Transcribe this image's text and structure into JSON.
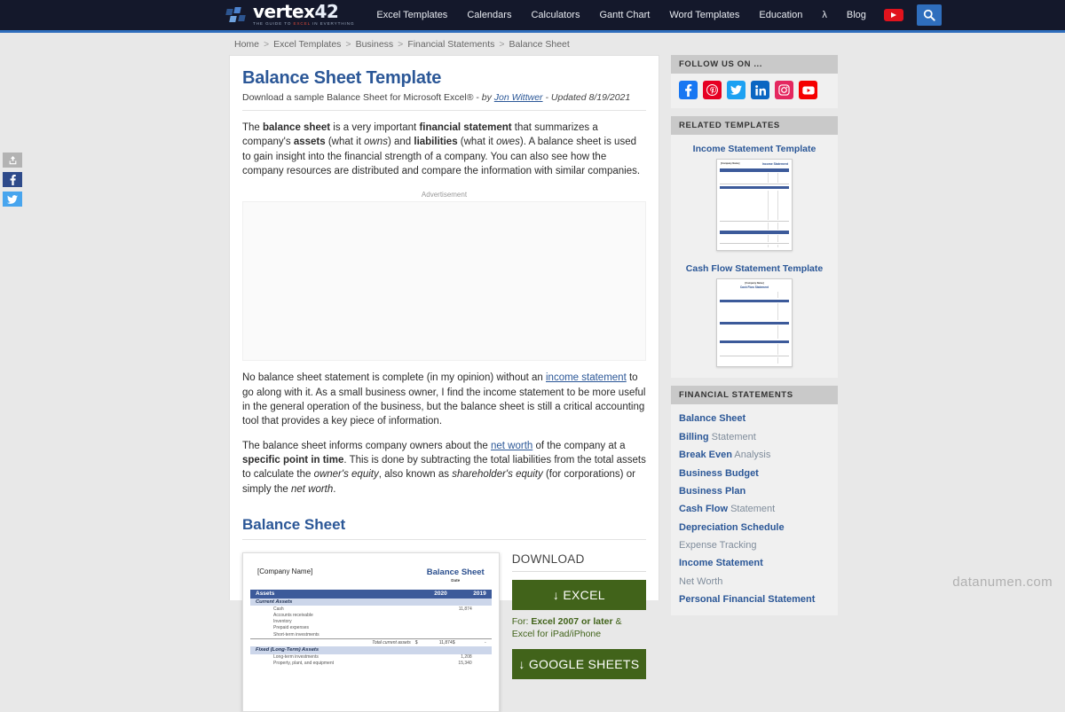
{
  "header": {
    "logo": {
      "word": "vertex",
      "number": "42",
      "tagline_prefix": "THE GUIDE TO ",
      "tagline_highlight": "EXCEL",
      "tagline_suffix": " IN EVERYTHING"
    },
    "nav": [
      {
        "label": "Excel Templates"
      },
      {
        "label": "Calendars"
      },
      {
        "label": "Calculators"
      },
      {
        "label": "Gantt Chart"
      },
      {
        "label": "Word Templates"
      },
      {
        "label": "Education"
      },
      {
        "label": "λ"
      },
      {
        "label": "Blog"
      }
    ],
    "youtube_icon": "youtube-play-icon",
    "search_icon": "search-icon"
  },
  "breadcrumb": {
    "separator": ">",
    "items": [
      "Home",
      "Excel Templates",
      "Business",
      "Financial Statements",
      "Balance Sheet"
    ]
  },
  "share_rail": [
    {
      "name": "share-more-button",
      "icon": "share-icon"
    },
    {
      "name": "share-facebook-button",
      "icon": "facebook-icon"
    },
    {
      "name": "share-twitter-button",
      "icon": "twitter-icon"
    }
  ],
  "main": {
    "title": "Balance Sheet Template",
    "subtitle_lead": "Download a sample Balance Sheet for Microsoft Excel® - ",
    "subtitle_by": "by ",
    "subtitle_author": "Jon Wittwer",
    "subtitle_updated": " - Updated 8/19/2021",
    "paragraph1": {
      "s1": "The ",
      "b1": "balance sheet",
      "s2": " is a very important ",
      "b2": "financial statement",
      "s3": " that summarizes a company's ",
      "b3": "assets",
      "s4": " (what it ",
      "i1": "owns",
      "s5": ") and ",
      "b4": "liabilities",
      "s6": " (what it ",
      "i2": "owes",
      "s7": "). A balance sheet is used to gain insight into the financial strength of a company. You can also see how the company resources are distributed and compare the information with similar companies."
    },
    "ad_label": "Advertisement",
    "paragraph2": {
      "s1": "No balance sheet statement is complete (in my opinion) without an ",
      "link": "income statement",
      "s2": " to go along with it. As a small business owner, I find the income statement to be more useful in the general operation of the business, but the balance sheet is still a critical accounting tool that provides a key piece of information."
    },
    "paragraph3": {
      "s1": "The balance sheet informs company owners about the ",
      "link": "net worth",
      "s2": " of the company at a ",
      "b1": "specific point in time",
      "s3": ". This is done by subtracting the total liabilities from the total assets to calculate the ",
      "i1": "owner's equity",
      "s4": ", also known as ",
      "i2": "shareholder's equity",
      "s5": " (for corporations) or simply the ",
      "i3": "net worth",
      "s6": "."
    },
    "section_heading": "Balance Sheet"
  },
  "preview": {
    "company": "[Company Name]",
    "title": "Balance Sheet",
    "date_label": "Date",
    "header_row": {
      "label": "Assets",
      "year1": "2020",
      "year2": "2019"
    },
    "current_assets_label": "Current Assets",
    "current_assets_rows": [
      {
        "label": "Cash",
        "value": "11,874"
      },
      {
        "label": "Accounts receivable",
        "value": ""
      },
      {
        "label": "Inventory",
        "value": ""
      },
      {
        "label": "Prepaid expenses",
        "value": ""
      },
      {
        "label": "Short-term investments",
        "value": ""
      }
    ],
    "total_current": {
      "label": "Total current assets",
      "c1": "$",
      "v1": "11,874",
      "c2": "$",
      "v2": "-"
    },
    "fixed_assets_label": "Fixed (Long-Term) Assets",
    "fixed_assets_rows": [
      {
        "label": "Long-term investments",
        "value": "1,208"
      },
      {
        "label": "Property, plant, and equipment",
        "value": "15,340"
      }
    ]
  },
  "download": {
    "title": "DOWNLOAD",
    "excel_button": "↓ EXCEL",
    "note_prefix": "For: ",
    "note_bold": "Excel 2007 or later",
    "note_suffix": " & Excel for iPad/iPhone",
    "sheets_button": "↓ GOOGLE SHEETS"
  },
  "sidebar": {
    "follow": {
      "heading": "FOLLOW US ON ...",
      "icons": [
        {
          "name": "facebook-icon",
          "color": "#1877f2"
        },
        {
          "name": "pinterest-icon",
          "color": "#e60023"
        },
        {
          "name": "twitter-icon",
          "color": "#1da1f2"
        },
        {
          "name": "linkedin-icon",
          "color": "#0a66c2"
        },
        {
          "name": "instagram-icon",
          "color": "#e4285f"
        },
        {
          "name": "youtube-icon",
          "color": "#f50000"
        }
      ]
    },
    "related": {
      "heading": "RELATED TEMPLATES",
      "items": [
        {
          "title": "Income Statement Template",
          "doc_title": "Income Statement",
          "doc_company": "[Company Name]"
        },
        {
          "title": "Cash Flow Statement Template",
          "doc_title": "Cash Flow Statement",
          "doc_company": "[Company Name]"
        }
      ]
    },
    "financial": {
      "heading": "FINANCIAL STATEMENTS",
      "items": [
        {
          "bold": "Balance Sheet",
          "dim": ""
        },
        {
          "bold": "Billing",
          "dim": " Statement"
        },
        {
          "bold": "Break Even",
          "dim": " Analysis"
        },
        {
          "bold": "Business Budget",
          "dim": ""
        },
        {
          "bold": "Business Plan",
          "dim": ""
        },
        {
          "bold": "Cash Flow",
          "dim": " Statement"
        },
        {
          "bold": "Depreciation Schedule",
          "dim": ""
        },
        {
          "bold": "",
          "dim": "Expense Tracking"
        },
        {
          "bold": "Income Statement",
          "dim": ""
        },
        {
          "bold": "",
          "dim": "Net Worth"
        },
        {
          "bold": "Personal Financial Statement",
          "dim": ""
        }
      ]
    }
  },
  "watermark": "datanumen.com"
}
